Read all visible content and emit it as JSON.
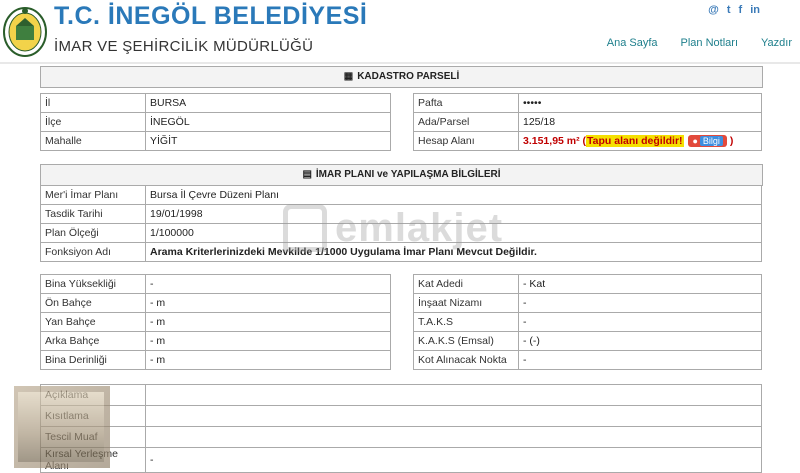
{
  "header": {
    "title": "T.C. İNEGÖL BELEDİYESİ",
    "subtitle": "İMAR VE ŞEHİRCİLİK MÜDÜRLÜĞÜ",
    "social": [
      "@",
      "t",
      "f",
      "in"
    ],
    "nav": [
      "Ana Sayfa",
      "Plan Notları",
      "Yazdır"
    ]
  },
  "kadastro": {
    "heading": "KADASTRO PARSELİ",
    "left": [
      {
        "label": "İl",
        "value": "BURSA"
      },
      {
        "label": "İlçe",
        "value": "İNEGÖL"
      },
      {
        "label": "Mahalle",
        "value": "YİĞİT"
      }
    ],
    "right": [
      {
        "label": "Pafta",
        "value": "•••••"
      },
      {
        "label": "Ada/Parsel",
        "value": "125/18"
      },
      {
        "label": "Hesap Alanı",
        "value": "3.151,95 m²",
        "paren_open": "(",
        "note": "Tapu alanı değildir!",
        "button": "Bilgi",
        "paren_close": ")"
      }
    ]
  },
  "imar": {
    "heading": "İMAR PLANI ve YAPILAŞMA BİLGİLERİ",
    "rows": [
      {
        "label": "Mer'i İmar Planı",
        "value": "Bursa İl Çevre Düzeni Planı"
      },
      {
        "label": "Tasdik Tarihi",
        "value": "19/01/1998"
      },
      {
        "label": "Plan Ölçeği",
        "value": "1/100000"
      },
      {
        "label": "Fonksiyon Adı",
        "value": "Arama Kriterlerinizdeki Mevkilde 1/1000 Uygulama İmar Planı Mevcut Değildir."
      }
    ]
  },
  "yapilasma": {
    "left": [
      {
        "label": "Bina Yüksekliği",
        "value": "-"
      },
      {
        "label": "Ön Bahçe",
        "value": "- m"
      },
      {
        "label": "Yan Bahçe",
        "value": "- m"
      },
      {
        "label": "Arka Bahçe",
        "value": "- m"
      },
      {
        "label": "Bina Derinliği",
        "value": "- m"
      }
    ],
    "right": [
      {
        "label": "Kat Adedi",
        "value": "- Kat"
      },
      {
        "label": "İnşaat Nizamı",
        "value": "-"
      },
      {
        "label": "T.A.K.S",
        "value": "-"
      },
      {
        "label": "K.A.K.S (Emsal)",
        "value": "- (-)"
      },
      {
        "label": "Kot Alınacak Nokta",
        "value": "-"
      }
    ]
  },
  "ek": {
    "rows": [
      {
        "label": "Açıklama",
        "value": ""
      },
      {
        "label": "Kısıtlama",
        "value": ""
      },
      {
        "label": "Tescil Muaf",
        "value": ""
      },
      {
        "label": "Kırsal Yerleşme Alanı",
        "value": "-"
      }
    ]
  },
  "watermark": "emlakjet",
  "colors": {
    "title": "#2a79b9",
    "nav": "#1e7f8c",
    "warning": "#c00000",
    "highlight": "#f5e000"
  }
}
